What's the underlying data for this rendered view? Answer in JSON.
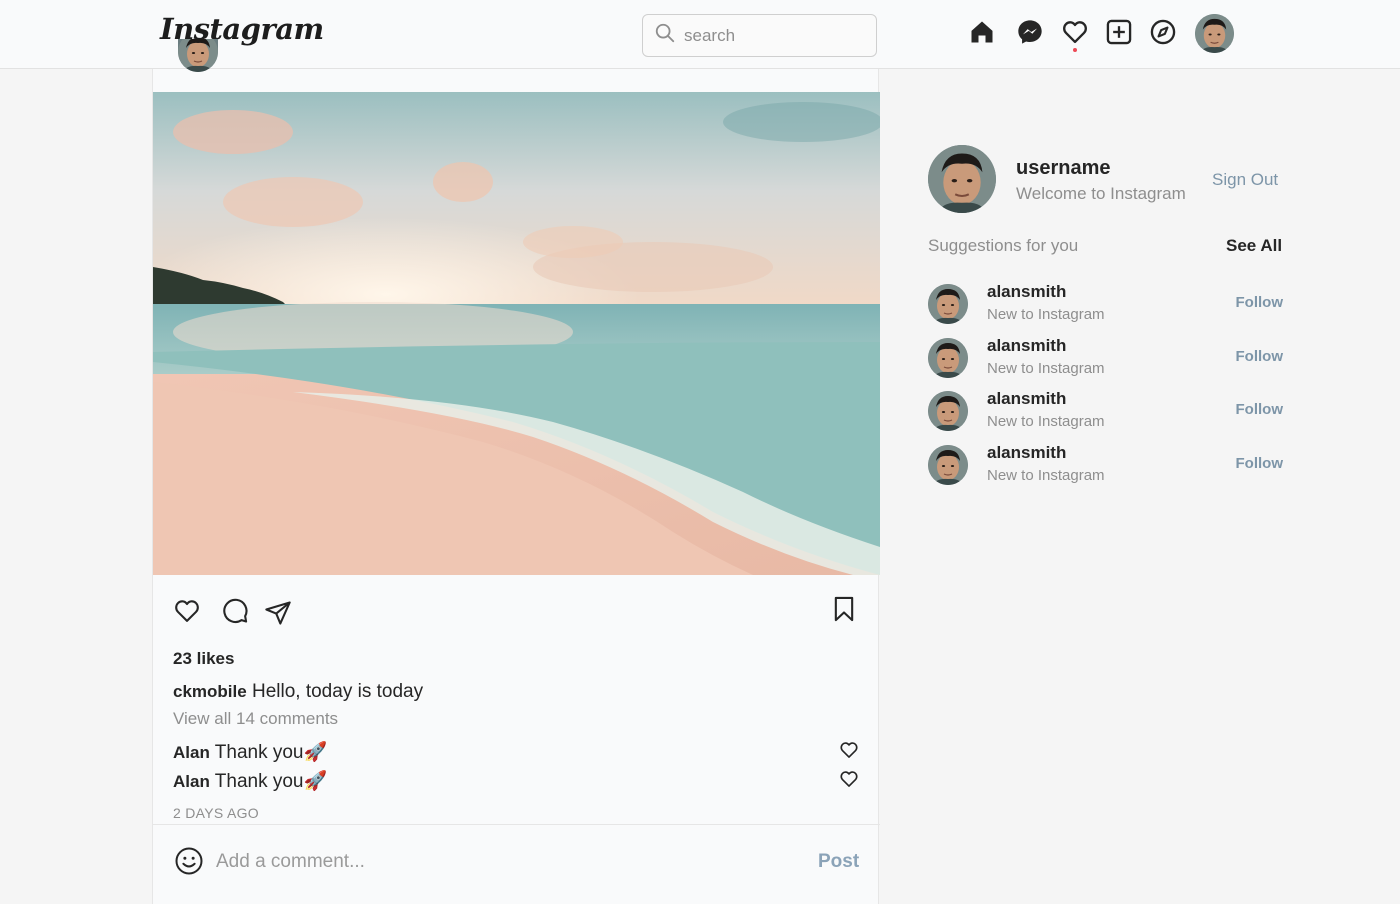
{
  "header": {
    "logo": "Instagram",
    "search_placeholder": "search"
  },
  "post": {
    "likes": "23 likes",
    "caption_user": "ckmobile",
    "caption_text": "Hello, today is today",
    "view_comments": "View all 14 comments",
    "comments": [
      {
        "user": "Alan",
        "text": "Thank you🚀"
      },
      {
        "user": "Alan",
        "text": "Thank you🚀"
      }
    ],
    "time": "2 DAYS AGO",
    "comment_placeholder": "Add a comment...",
    "post_button": "Post"
  },
  "sidebar": {
    "username": "username",
    "subtitle": "Welcome to Instagram",
    "sign_out": "Sign Out",
    "suggestions_title": "Suggestions for you",
    "see_all": "See All",
    "suggestions": [
      {
        "name": "alansmith",
        "sub": "New to Instagram",
        "action": "Follow"
      },
      {
        "name": "alansmith",
        "sub": "New to Instagram",
        "action": "Follow"
      },
      {
        "name": "alansmith",
        "sub": "New to Instagram",
        "action": "Follow"
      },
      {
        "name": "alansmith",
        "sub": "New to Instagram",
        "action": "Follow"
      }
    ]
  },
  "icons": {
    "nav": [
      "home-icon",
      "messenger-icon",
      "heart-icon",
      "new-post-icon",
      "explore-icon"
    ],
    "actions": [
      "like-icon",
      "comment-icon",
      "share-icon",
      "bookmark-icon"
    ]
  },
  "colors": {
    "link": "#7d95a8",
    "muted": "#8e8e8e",
    "notification_dot": "#ed4956"
  }
}
